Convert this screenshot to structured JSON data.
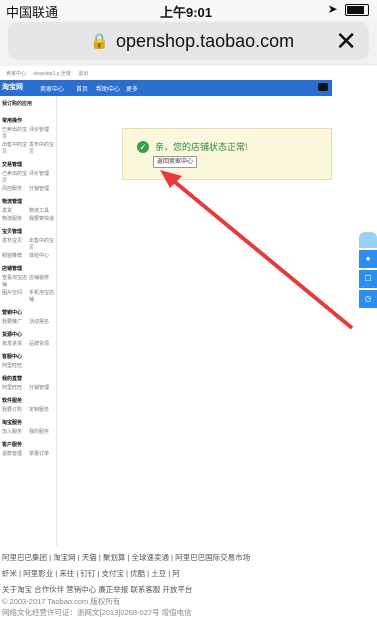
{
  "status": {
    "carrier": "中国联通",
    "time": "上午9:01"
  },
  "url": "openshop.taobao.com",
  "page": {
    "topnav": [
      "卖家中心",
      "ebaydep1.p.全链",
      "退出"
    ],
    "header": {
      "logo": "淘宝网",
      "tabs": [
        "卖家中心",
        "首页",
        "帮助中心",
        "更多"
      ]
    },
    "sidebar": {
      "title": "我订购的应用",
      "sections": [
        {
          "title": "常用操作",
          "items": [
            "已卖出的宝贝",
            "评价管理",
            "出售中的宝贝",
            "发布中的宝贝"
          ]
        },
        {
          "title": "交易管理",
          "items": [
            "已卖出的宝贝",
            "评价管理",
            "风控服务",
            "分销管理"
          ]
        },
        {
          "title": "物流管理",
          "items": [
            "发货",
            "物流工具",
            "物流服务",
            "我要寄快递"
          ]
        },
        {
          "title": "宝贝管理",
          "items": [
            "发布宝贝",
            "出售中的宝贝",
            "橱窗推荐",
            "体检中心"
          ]
        },
        {
          "title": "店铺管理",
          "items": [
            "查看淘宝店铺",
            "店铺装修",
            "图片空间",
            "手机淘宝店铺"
          ]
        },
        {
          "title": "营销中心",
          "items": [
            "我要推广",
            "活动报名"
          ]
        },
        {
          "title": "货源中心",
          "items": [
            "批发进货",
            "品牌货源"
          ]
        },
        {
          "title": "客服中心",
          "items": [
            "阿里旺旺"
          ]
        },
        {
          "title": "我的直营",
          "items": [
            "阿里旺旺",
            "分销管理"
          ]
        },
        {
          "title": "软件服务",
          "items": [
            "我要订购",
            "定制服务"
          ]
        },
        {
          "title": "淘宝服务",
          "items": [
            "加入服务",
            "我的服务"
          ]
        },
        {
          "title": "客户服务",
          "items": [
            "退款管理",
            "举报订单"
          ]
        }
      ]
    },
    "notice": {
      "message": "亲，您的店铺状态正常!",
      "button": "返回卖家中心"
    },
    "footer": {
      "row1": "阿里巴巴集团 | 淘宝网 | 天猫 | 聚划算 | 全球速卖通 | 阿里巴巴国际交易市场",
      "row2": "虾米 | 阿里影业 | 来往 | 钉钉 | 支付宝 | 优酷 | 土豆 | 阿",
      "row3": "关于淘宝 合作伙伴 营销中心 廉正举报 联系客服 开放平台",
      "row4": "© 2003-2017 Taobao.com 版权所有",
      "row5": "网络文化经营许可证：浙网文[2013]0268-027号 增值电信"
    }
  }
}
